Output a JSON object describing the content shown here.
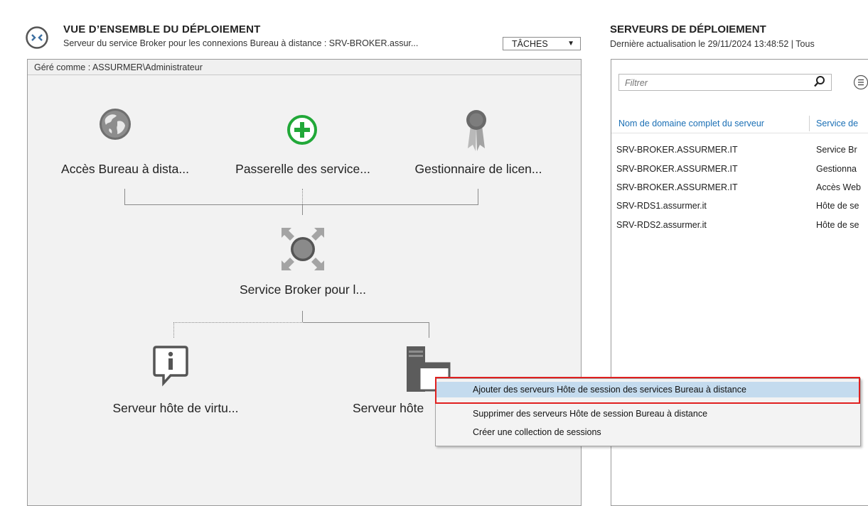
{
  "overview": {
    "title": "VUE D’ENSEMBLE DU DÉPLOIEMENT",
    "subtitle": "Serveur du service Broker pour les connexions Bureau à distance : SRV-BROKER.assur...",
    "tasks_label": "TÂCHES",
    "managed_as": "Géré comme : ASSURMER\\Administrateur",
    "nodes": {
      "web_access": "Accès Bureau à dista...",
      "gateway": "Passerelle des service...",
      "licensing": "Gestionnaire de licen...",
      "broker": "Service Broker pour l...",
      "virtualization_host": "Serveur hôte de virtu...",
      "session_host": "Serveur hôte"
    }
  },
  "servers": {
    "title": "SERVEURS DE DÉPLOIEMENT",
    "subtitle": "Dernière actualisation le 29/11/2024 13:48:52 | Tous",
    "filter_placeholder": "Filtrer",
    "columns": [
      "Nom de domaine complet du serveur",
      "Service de"
    ],
    "rows": [
      {
        "fqdn": "SRV-BROKER.ASSURMER.IT",
        "role": "Service Br"
      },
      {
        "fqdn": "SRV-BROKER.ASSURMER.IT",
        "role": "Gestionna"
      },
      {
        "fqdn": "SRV-BROKER.ASSURMER.IT",
        "role": "Accès Web"
      },
      {
        "fqdn": "SRV-RDS1.assurmer.it",
        "role": "Hôte de se"
      },
      {
        "fqdn": "SRV-RDS2.assurmer.it",
        "role": "Hôte de se"
      }
    ]
  },
  "context_menu": {
    "items": [
      "Ajouter des serveurs Hôte de session des services Bureau à distance",
      "Supprimer des serveurs Hôte de session Bureau à distance",
      "Créer une collection de sessions"
    ]
  },
  "colors": {
    "accent_link": "#1a6fb5",
    "gateway_green": "#21a838",
    "highlight": "#c4dbee",
    "callout_red": "#e0201f"
  },
  "icons": {
    "overview": "remote-desktop-icon",
    "web_access": "globe-icon",
    "gateway": "plus-circle-icon",
    "licensing": "award-ribbon-icon",
    "broker": "broker-hub-icon",
    "virtualization_host": "info-speech-icon",
    "session_host": "server-window-icon"
  }
}
